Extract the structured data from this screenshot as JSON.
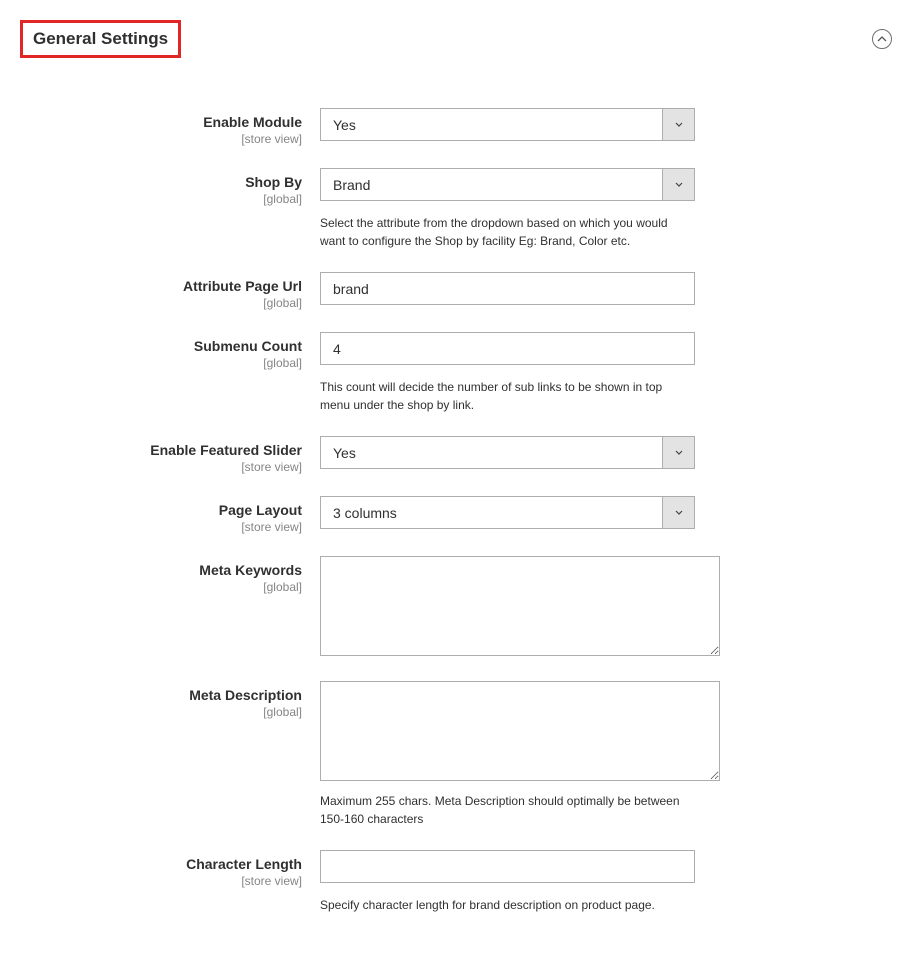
{
  "section": {
    "title": "General Settings"
  },
  "scopes": {
    "store_view": "[store view]",
    "global": "[global]"
  },
  "fields": {
    "enable_module": {
      "label": "Enable Module",
      "value": "Yes"
    },
    "shop_by": {
      "label": "Shop By",
      "value": "Brand",
      "help": "Select the attribute from the dropdown based on which you would want to configure the Shop by facility Eg: Brand, Color etc."
    },
    "attribute_page_url": {
      "label": "Attribute Page Url",
      "value": "brand"
    },
    "submenu_count": {
      "label": "Submenu Count",
      "value": "4",
      "help": "This count will decide the number of sub links to be shown in top menu under the shop by link."
    },
    "enable_featured_slider": {
      "label": "Enable Featured Slider",
      "value": "Yes"
    },
    "page_layout": {
      "label": "Page Layout",
      "value": "3 columns"
    },
    "meta_keywords": {
      "label": "Meta Keywords",
      "value": ""
    },
    "meta_description": {
      "label": "Meta Description",
      "value": "",
      "help": "Maximum 255 chars. Meta Description should optimally be between 150-160 characters"
    },
    "character_length": {
      "label": "Character Length",
      "value": "",
      "help": "Specify character length for brand description on product page."
    }
  }
}
